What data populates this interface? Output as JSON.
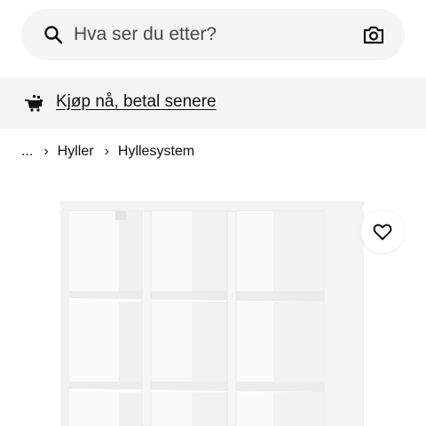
{
  "search": {
    "placeholder": "Hva ser du etter?",
    "search_icon": "search-icon",
    "camera_icon": "camera-icon"
  },
  "promo": {
    "icon": "buy-now-pay-later-icon",
    "link_text": "Kjøp nå, betal senere"
  },
  "breadcrumb": {
    "items": [
      "...",
      "Hyller",
      "Hyllesystem"
    ],
    "separator_icon": "chevron-right-icon"
  },
  "product": {
    "image": "white-shelving-unit",
    "favorite_icon": "heart-icon"
  },
  "colors": {
    "background": "#ffffff",
    "surface": "#f5f5f5",
    "text": "#111111"
  }
}
